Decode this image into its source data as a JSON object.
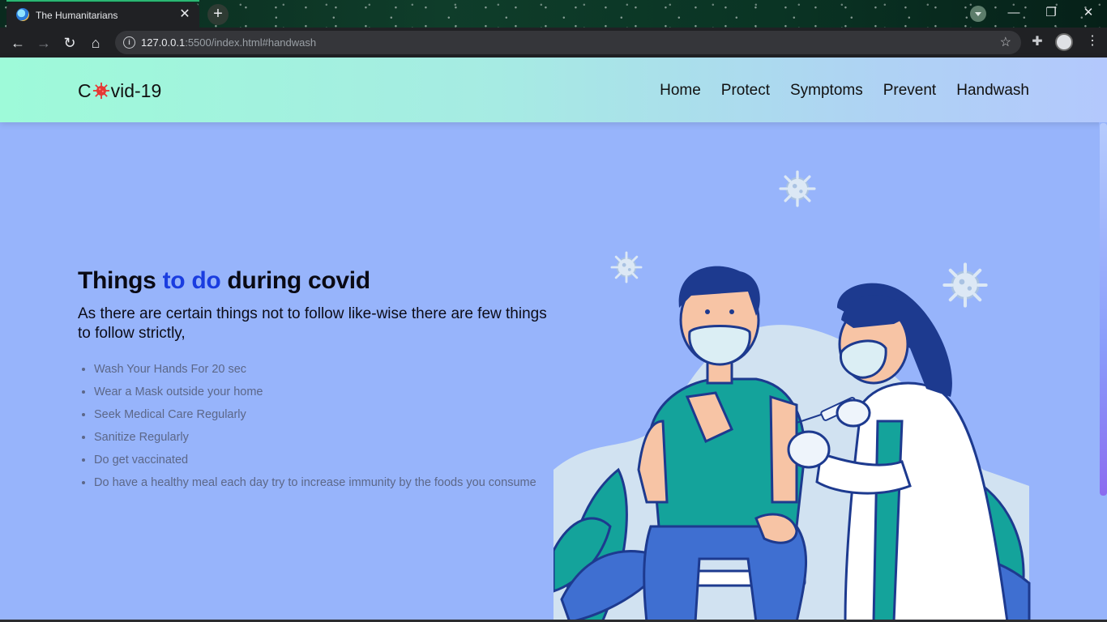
{
  "browser": {
    "tab_title": "The Humanitarians",
    "tab_close": "✕",
    "new_tab": "+",
    "url_host": "127.0.0.1",
    "url_path": ":5500/index.html#handwash",
    "window_controls": {
      "minimize": "—",
      "restore": "❐",
      "close": "✕"
    }
  },
  "navbar": {
    "logo_prefix": "C",
    "logo_suffix": "vid-19",
    "links": [
      "Home",
      "Protect",
      "Symptoms",
      "Prevent",
      "Handwash"
    ]
  },
  "main": {
    "headline_part1": "Things ",
    "headline_accent": "to do",
    "headline_part2": " during covid",
    "subtext": "As there are certain things not to follow like-wise there are few things to follow strictly,",
    "items": [
      "Wash Your Hands For 20 sec",
      "Wear a Mask outside your home",
      "Seek Medical Care Regularly",
      "Sanitize Regularly",
      "Do get vaccinated",
      "Do have a healthy meal each day try to increase immunity by the foods you consume"
    ]
  },
  "colors": {
    "page_background": "#97b4fb",
    "accent": "#1a3de0",
    "navbar_gradient_start": "#9efad9",
    "navbar_gradient_end": "#b3c8fd",
    "teal": "#14a39b",
    "navy": "#1d3a8f"
  },
  "icons": [
    "back-icon",
    "forward-icon",
    "reload-icon",
    "home-icon",
    "info-icon",
    "star-icon",
    "extensions-icon",
    "profile-icon",
    "menu-icon",
    "virus-icon"
  ]
}
